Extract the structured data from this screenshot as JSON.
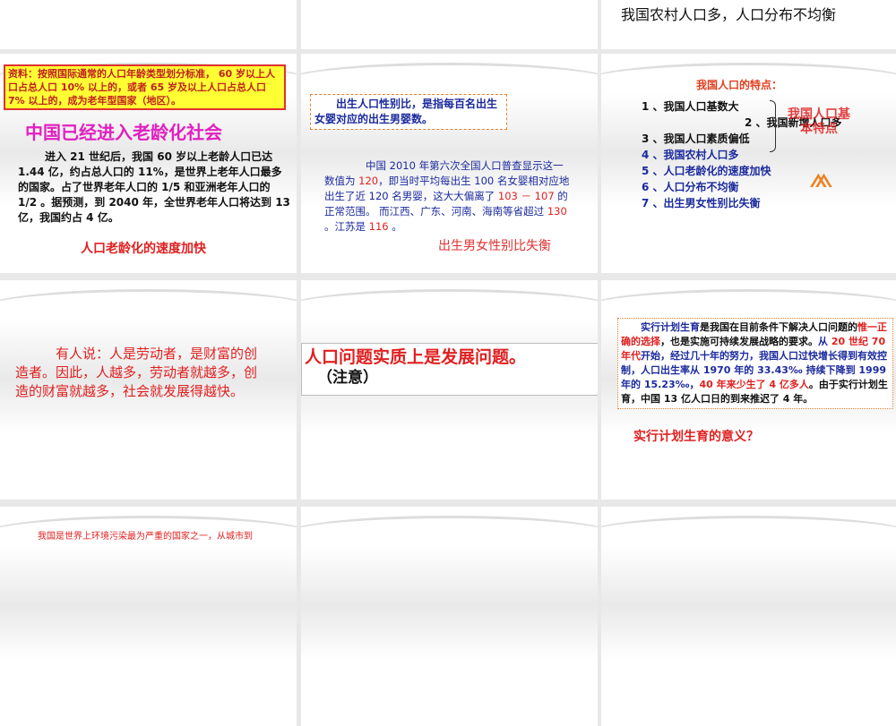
{
  "slides": {
    "s3_title": "我国农村人口多，人口分布不均衡",
    "s4": {
      "box": "资料：按照国际通常的人口年龄类型划分标准， 60 岁以上人口占总人口 10% 以上的，或者 65 岁及以上人口占总人口 7% 以上的，成为老年型国家（地区）。",
      "title": "中国已经进入老龄化社会",
      "body": "进入 21 世纪后，我国 60 岁以上老龄人口已达 1.44 亿，约占总人口的 11%，是世界上老年人口最多的国家。占了世界老年人口的 1/5 和亚洲老年人口的 1/2 。据预测，到 2040 年，全世界老年人口将达到 13 亿，我国约占 4 亿。",
      "footer": "人口老龄化的速度加快"
    },
    "s5": {
      "box": "出生人口性别比，是指每百名出生女婴对应的出生男婴数。",
      "p1": "中国 2010 年第六次全国人口普查显示这一数值为 ",
      "v1": "120",
      "p2": "，即当时平均每出生 100 名女婴相对应地出生了近 120 名男婴，这大大偏离了 ",
      "v2": "103 － 107",
      "p3": " 的正常范围。 而江西、广东、河南、海南等省超过 ",
      "v3": "130",
      "p4": " 。江苏是 ",
      "v4": "116",
      "p5": " 。",
      "footer": "出生男女性别比失衡"
    },
    "s6": {
      "title": "我国人口的特点：",
      "items": [
        "1 、我国人口基数大",
        "2 、我国新增人口多",
        "3 、我国人口素质偏低",
        "4 、我国农村人口多",
        "5 、人口老龄化的速度加快",
        "6 、人口分布不均衡",
        "7 、出生男女性别比失衡"
      ],
      "bracket_label": "我国人口基本特点"
    },
    "s7": {
      "body": "有人说：人是劳动者，是财富的创造者。因此，人越多，劳动者就越多，创造的财富就越多，社会就发展得越快。"
    },
    "s8": {
      "title": "人口问题实质上是发展问题。",
      "note": "（注意）"
    },
    "s9": {
      "a": "实行计划生育",
      "b": "是我国在目前条件下解决人口问题的",
      "c": "惟一正确的选择",
      "d": "，也是实施可持续发展战略的要求。",
      "e": "从 ",
      "f": "20 世纪 70 年代",
      "g": "开始，经过几十年的努力，我国人口过快增长得到有效控制，人口出生率从 1970 年的 33.43‰ 持续下降到 1999 年的 15.23‰，",
      "h": "40 年来少生了 4 亿多人",
      "i": "。由于实行计划生育，中国 13 亿人口日的到来推迟了 4 年。",
      "question": "实行计划生育的意义？"
    },
    "s10": {
      "text": "我国是世界上环境污染最为严重的国家之一，从城市到"
    }
  }
}
